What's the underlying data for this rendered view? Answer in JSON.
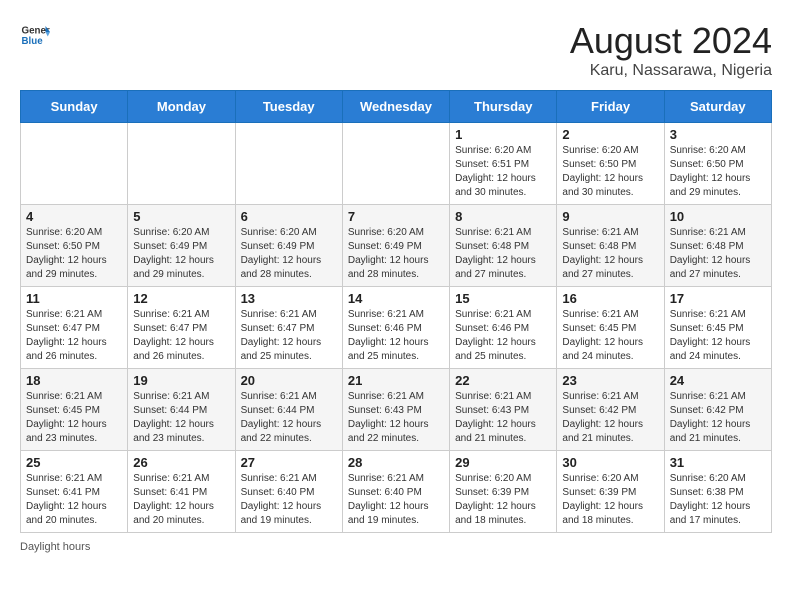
{
  "logo": {
    "general": "General",
    "blue": "Blue"
  },
  "title": "August 2024",
  "subtitle": "Karu, Nassarawa, Nigeria",
  "weekdays": [
    "Sunday",
    "Monday",
    "Tuesday",
    "Wednesday",
    "Thursday",
    "Friday",
    "Saturday"
  ],
  "footer": "Daylight hours",
  "weeks": [
    [
      {
        "day": "",
        "info": ""
      },
      {
        "day": "",
        "info": ""
      },
      {
        "day": "",
        "info": ""
      },
      {
        "day": "",
        "info": ""
      },
      {
        "day": "1",
        "info": "Sunrise: 6:20 AM\nSunset: 6:51 PM\nDaylight: 12 hours and 30 minutes."
      },
      {
        "day": "2",
        "info": "Sunrise: 6:20 AM\nSunset: 6:50 PM\nDaylight: 12 hours and 30 minutes."
      },
      {
        "day": "3",
        "info": "Sunrise: 6:20 AM\nSunset: 6:50 PM\nDaylight: 12 hours and 29 minutes."
      }
    ],
    [
      {
        "day": "4",
        "info": "Sunrise: 6:20 AM\nSunset: 6:50 PM\nDaylight: 12 hours and 29 minutes."
      },
      {
        "day": "5",
        "info": "Sunrise: 6:20 AM\nSunset: 6:49 PM\nDaylight: 12 hours and 29 minutes."
      },
      {
        "day": "6",
        "info": "Sunrise: 6:20 AM\nSunset: 6:49 PM\nDaylight: 12 hours and 28 minutes."
      },
      {
        "day": "7",
        "info": "Sunrise: 6:20 AM\nSunset: 6:49 PM\nDaylight: 12 hours and 28 minutes."
      },
      {
        "day": "8",
        "info": "Sunrise: 6:21 AM\nSunset: 6:48 PM\nDaylight: 12 hours and 27 minutes."
      },
      {
        "day": "9",
        "info": "Sunrise: 6:21 AM\nSunset: 6:48 PM\nDaylight: 12 hours and 27 minutes."
      },
      {
        "day": "10",
        "info": "Sunrise: 6:21 AM\nSunset: 6:48 PM\nDaylight: 12 hours and 27 minutes."
      }
    ],
    [
      {
        "day": "11",
        "info": "Sunrise: 6:21 AM\nSunset: 6:47 PM\nDaylight: 12 hours and 26 minutes."
      },
      {
        "day": "12",
        "info": "Sunrise: 6:21 AM\nSunset: 6:47 PM\nDaylight: 12 hours and 26 minutes."
      },
      {
        "day": "13",
        "info": "Sunrise: 6:21 AM\nSunset: 6:47 PM\nDaylight: 12 hours and 25 minutes."
      },
      {
        "day": "14",
        "info": "Sunrise: 6:21 AM\nSunset: 6:46 PM\nDaylight: 12 hours and 25 minutes."
      },
      {
        "day": "15",
        "info": "Sunrise: 6:21 AM\nSunset: 6:46 PM\nDaylight: 12 hours and 25 minutes."
      },
      {
        "day": "16",
        "info": "Sunrise: 6:21 AM\nSunset: 6:45 PM\nDaylight: 12 hours and 24 minutes."
      },
      {
        "day": "17",
        "info": "Sunrise: 6:21 AM\nSunset: 6:45 PM\nDaylight: 12 hours and 24 minutes."
      }
    ],
    [
      {
        "day": "18",
        "info": "Sunrise: 6:21 AM\nSunset: 6:45 PM\nDaylight: 12 hours and 23 minutes."
      },
      {
        "day": "19",
        "info": "Sunrise: 6:21 AM\nSunset: 6:44 PM\nDaylight: 12 hours and 23 minutes."
      },
      {
        "day": "20",
        "info": "Sunrise: 6:21 AM\nSunset: 6:44 PM\nDaylight: 12 hours and 22 minutes."
      },
      {
        "day": "21",
        "info": "Sunrise: 6:21 AM\nSunset: 6:43 PM\nDaylight: 12 hours and 22 minutes."
      },
      {
        "day": "22",
        "info": "Sunrise: 6:21 AM\nSunset: 6:43 PM\nDaylight: 12 hours and 21 minutes."
      },
      {
        "day": "23",
        "info": "Sunrise: 6:21 AM\nSunset: 6:42 PM\nDaylight: 12 hours and 21 minutes."
      },
      {
        "day": "24",
        "info": "Sunrise: 6:21 AM\nSunset: 6:42 PM\nDaylight: 12 hours and 21 minutes."
      }
    ],
    [
      {
        "day": "25",
        "info": "Sunrise: 6:21 AM\nSunset: 6:41 PM\nDaylight: 12 hours and 20 minutes."
      },
      {
        "day": "26",
        "info": "Sunrise: 6:21 AM\nSunset: 6:41 PM\nDaylight: 12 hours and 20 minutes."
      },
      {
        "day": "27",
        "info": "Sunrise: 6:21 AM\nSunset: 6:40 PM\nDaylight: 12 hours and 19 minutes."
      },
      {
        "day": "28",
        "info": "Sunrise: 6:21 AM\nSunset: 6:40 PM\nDaylight: 12 hours and 19 minutes."
      },
      {
        "day": "29",
        "info": "Sunrise: 6:20 AM\nSunset: 6:39 PM\nDaylight: 12 hours and 18 minutes."
      },
      {
        "day": "30",
        "info": "Sunrise: 6:20 AM\nSunset: 6:39 PM\nDaylight: 12 hours and 18 minutes."
      },
      {
        "day": "31",
        "info": "Sunrise: 6:20 AM\nSunset: 6:38 PM\nDaylight: 12 hours and 17 minutes."
      }
    ]
  ]
}
